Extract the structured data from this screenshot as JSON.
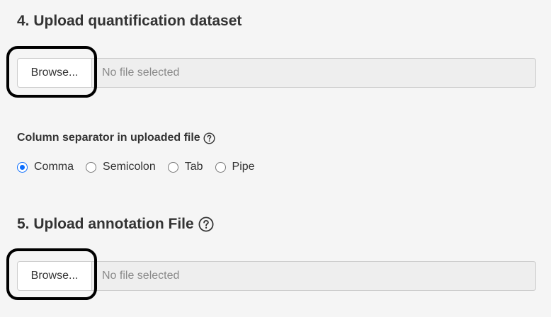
{
  "section4": {
    "title": "4. Upload quantification dataset",
    "browse_label": "Browse...",
    "file_placeholder": "No file selected"
  },
  "separator": {
    "label": "Column separator in uploaded file",
    "options": [
      {
        "label": "Comma",
        "checked": true
      },
      {
        "label": "Semicolon",
        "checked": false
      },
      {
        "label": "Tab",
        "checked": false
      },
      {
        "label": "Pipe",
        "checked": false
      }
    ]
  },
  "section5": {
    "title": "5. Upload annotation File",
    "browse_label": "Browse...",
    "file_placeholder": "No file selected"
  },
  "colors": {
    "accent": "#0d6efd",
    "highlight": "#000000"
  },
  "icons": {
    "help": "question-circle-icon"
  }
}
